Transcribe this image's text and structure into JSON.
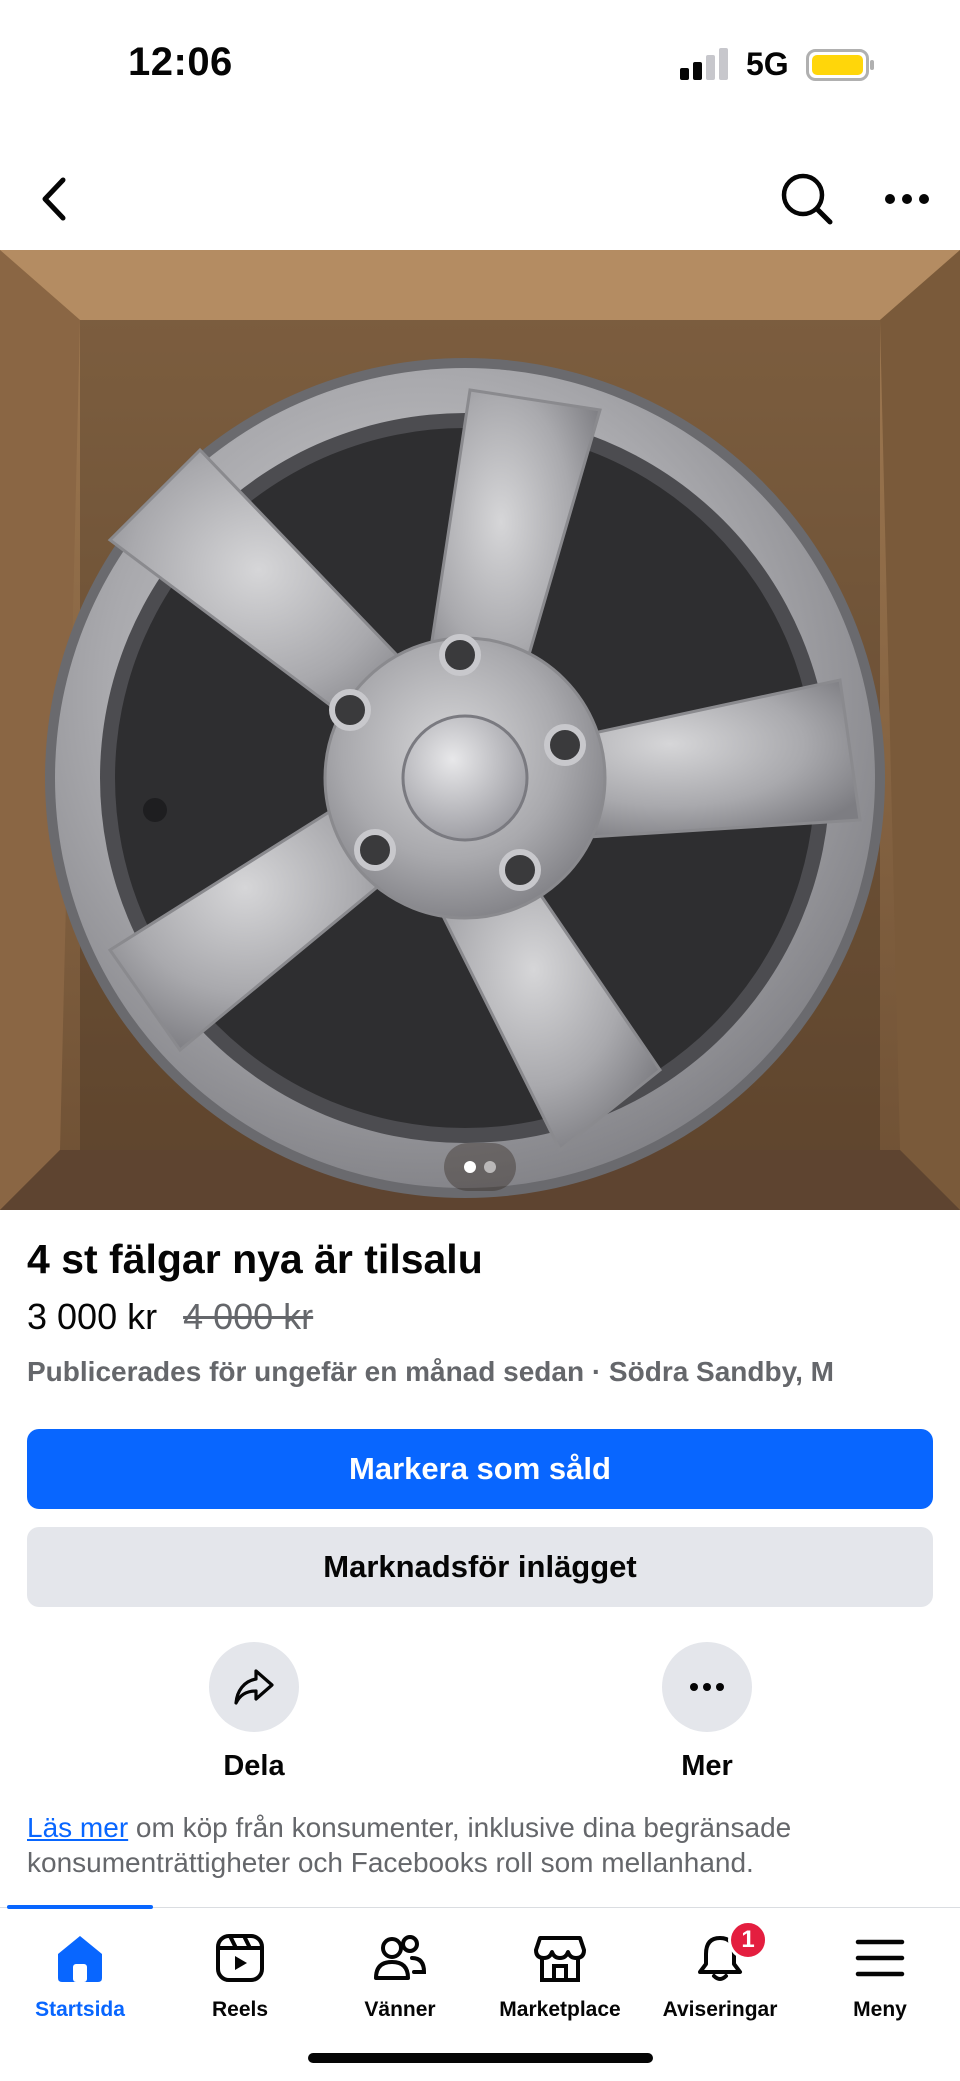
{
  "status_bar": {
    "time": "12:06",
    "network": "5G"
  },
  "listing": {
    "title": "4 st fälgar nya är tilsalu",
    "price": "3 000 kr",
    "old_price": "4 000 kr",
    "meta": "Publicerades för ungefär en månad sedan · Södra Sandby, M",
    "photo_count": 2,
    "active_photo": 1
  },
  "buttons": {
    "mark_sold": "Markera som såld",
    "promote": "Marknadsför inlägget"
  },
  "actions": {
    "share_label": "Dela",
    "more_label": "Mer"
  },
  "disclaimer": {
    "link_text": "Läs mer",
    "text": " om köp från konsumenter, inklusive dina begränsade konsumenträttigheter och Facebooks roll som mellanhand."
  },
  "tabs": [
    {
      "label": "Startsida",
      "icon": "home-icon",
      "active": true
    },
    {
      "label": "Reels",
      "icon": "reels-icon"
    },
    {
      "label": "Vänner",
      "icon": "friends-icon"
    },
    {
      "label": "Marketplace",
      "icon": "marketplace-icon"
    },
    {
      "label": "Aviseringar",
      "icon": "bell-icon",
      "badge": "1"
    },
    {
      "label": "Meny",
      "icon": "menu-icon"
    }
  ],
  "colors": {
    "accent": "#0866ff",
    "badge": "#e41e3f",
    "secondary_button": "#e4e6eb",
    "muted_text": "#65676b",
    "battery": "#ffd60a"
  }
}
